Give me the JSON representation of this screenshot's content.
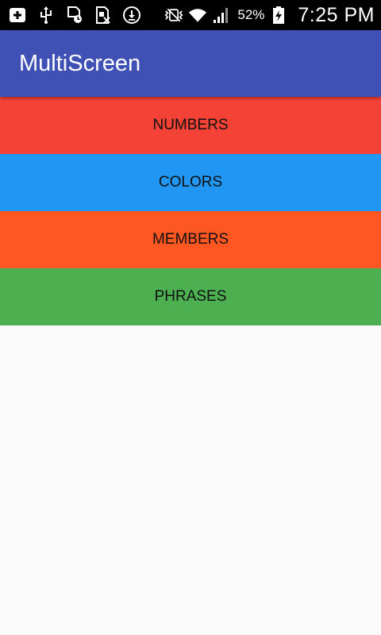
{
  "status_bar": {
    "icons_left": [
      "add-notification-icon",
      "usb-icon",
      "sim-clock-icon",
      "sim-blocked-icon",
      "download-icon"
    ],
    "icons_right": [
      "vibrate-mute-icon",
      "wifi-icon",
      "signal-icon",
      "battery-charging-icon"
    ],
    "battery_percent": "52%",
    "time": "7:25 PM"
  },
  "app_bar": {
    "title": "MultiScreen",
    "color": "#3f51b5"
  },
  "categories": [
    {
      "label": "NUMBERS",
      "color": "#f44336"
    },
    {
      "label": "COLORS",
      "color": "#2196f3"
    },
    {
      "label": "MEMBERS",
      "color": "#ff5722"
    },
    {
      "label": "PHRASES",
      "color": "#4caf50"
    }
  ]
}
